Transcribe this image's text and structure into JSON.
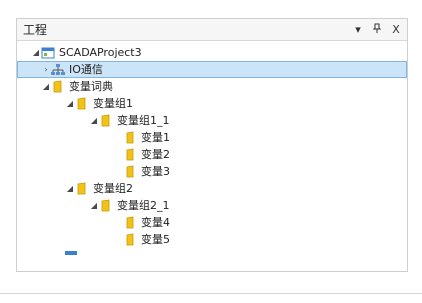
{
  "panel": {
    "title": "工程",
    "actions": {
      "pin": "▾",
      "autohide": "ᛒ",
      "close": "X"
    }
  },
  "tree": {
    "items": [
      {
        "label": "SCADAProject3",
        "toggle": "◢",
        "icon": "project-icon"
      },
      {
        "label": "IO通信",
        "toggle": "›",
        "icon": "network-icon",
        "selected": true
      },
      {
        "label": "变量词典",
        "toggle": "◢",
        "icon": "folder-icon"
      },
      {
        "label": "变量组1",
        "toggle": "◢",
        "icon": "folder-icon"
      },
      {
        "label": "变量组1_1",
        "toggle": "◢",
        "icon": "folder-icon"
      },
      {
        "label": "变量1",
        "toggle": "",
        "icon": "variable-icon"
      },
      {
        "label": "变量2",
        "toggle": "",
        "icon": "variable-icon"
      },
      {
        "label": "变量3",
        "toggle": "",
        "icon": "variable-icon"
      },
      {
        "label": "变量组2",
        "toggle": "◢",
        "icon": "folder-icon"
      },
      {
        "label": "变量组2_1",
        "toggle": "◢",
        "icon": "folder-icon"
      },
      {
        "label": "变量4",
        "toggle": "",
        "icon": "variable-icon"
      },
      {
        "label": "变量5",
        "toggle": "",
        "icon": "variable-icon"
      }
    ]
  },
  "colors": {
    "folder": "#f2c21b",
    "selection": "#cce4f7",
    "project": "#3b7fd0"
  }
}
